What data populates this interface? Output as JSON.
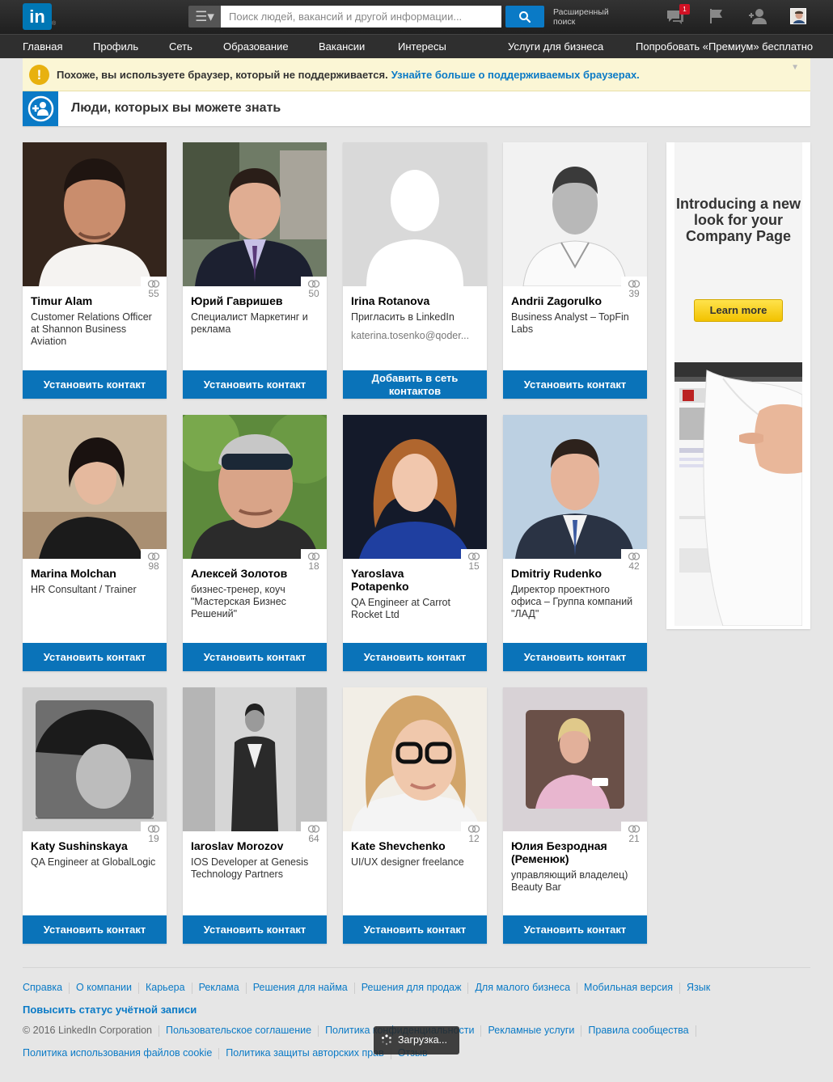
{
  "header": {
    "logo_text": "in",
    "logo_reg": "®",
    "search_placeholder": "Поиск людей, вакансий и другой информации...",
    "advanced_search": "Расширенный поиск",
    "messages_badge": "1"
  },
  "nav": {
    "items": [
      "Главная",
      "Профиль",
      "Сеть",
      "Образование",
      "Вакансии",
      "Интересы"
    ],
    "business": "Услуги для бизнеса",
    "premium": "Попробовать «Премиум» бесплатно"
  },
  "alert": {
    "text": "Похоже, вы используете браузер, который не поддерживается.",
    "link": "Узнайте больше о поддерживаемых браузерах."
  },
  "pymk": {
    "title": "Люди, которых вы можете знать"
  },
  "cards": [
    {
      "name": "Timur Alam",
      "headline": "Customer Relations Officer at Shannon Business Aviation",
      "shared": "55",
      "button": "Установить контакт"
    },
    {
      "name": "Юрий Гавришев",
      "headline": "Специалист Маркетинг и реклама",
      "shared": "50",
      "button": "Установить контакт"
    },
    {
      "name": "Irina Rotanova",
      "headline": "Пригласить в LinkedIn",
      "email": "katerina.tosenko@qoder...",
      "shared": "",
      "button": "Добавить в сеть контактов"
    },
    {
      "name": "Andrii Zagorulko",
      "headline": "Business Analyst – TopFin Labs",
      "shared": "39",
      "button": "Установить контакт"
    },
    {
      "name": "Marina Molchan",
      "headline": "HR Consultant / Trainer",
      "shared": "98",
      "button": "Установить контакт"
    },
    {
      "name": "Алексей Золотов",
      "headline": "бизнес-тренер, коуч \"Мастерская Бизнес Решений\"",
      "shared": "18",
      "button": "Установить контакт"
    },
    {
      "name": "Yaroslava Potapenko",
      "headline": "QA Engineer at Carrot Rocket Ltd",
      "shared": "15",
      "button": "Установить контакт"
    },
    {
      "name": "Dmitriy Rudenko",
      "headline": "Директор проектного офиса – Группа компаний \"ЛАД\"",
      "shared": "42",
      "button": "Установить контакт"
    },
    {
      "name": "Katy Sushinskaya",
      "headline": "QA Engineer at GlobalLogic",
      "shared": "19",
      "button": "Установить контакт"
    },
    {
      "name": "Iaroslav Morozov",
      "headline": "IOS Developer at Genesis Technology Partners",
      "shared": "64",
      "button": "Установить контакт"
    },
    {
      "name": "Kate Shevchenko",
      "headline": "UI/UX designer freelance",
      "shared": "12",
      "button": "Установить контакт"
    },
    {
      "name": "Юлия Безродная (Ременюк)",
      "headline": "управляющий владелец) Beauty Bar",
      "shared": "21",
      "button": "Установить контакт"
    }
  ],
  "ad": {
    "title": "Introducing a new look for your Company Page",
    "button": "Learn more"
  },
  "footer": {
    "row1": [
      "Справка",
      "О компании",
      "Карьера",
      "Реклама",
      "Решения для найма",
      "Решения для продаж",
      "Для малого бизнеса",
      "Мобильная версия",
      "Язык"
    ],
    "upgrade": "Повысить статус учётной записи",
    "copyright": "© 2016 LinkedIn Corporation",
    "row3": [
      "Пользовательское соглашение",
      "Политика конфиденциальности",
      "Рекламные услуги",
      "Правила сообщества"
    ],
    "row4": [
      "Политика использования файлов cookie",
      "Политика защиты авторских прав",
      "Отзыв"
    ]
  },
  "loading": "Загрузка..."
}
